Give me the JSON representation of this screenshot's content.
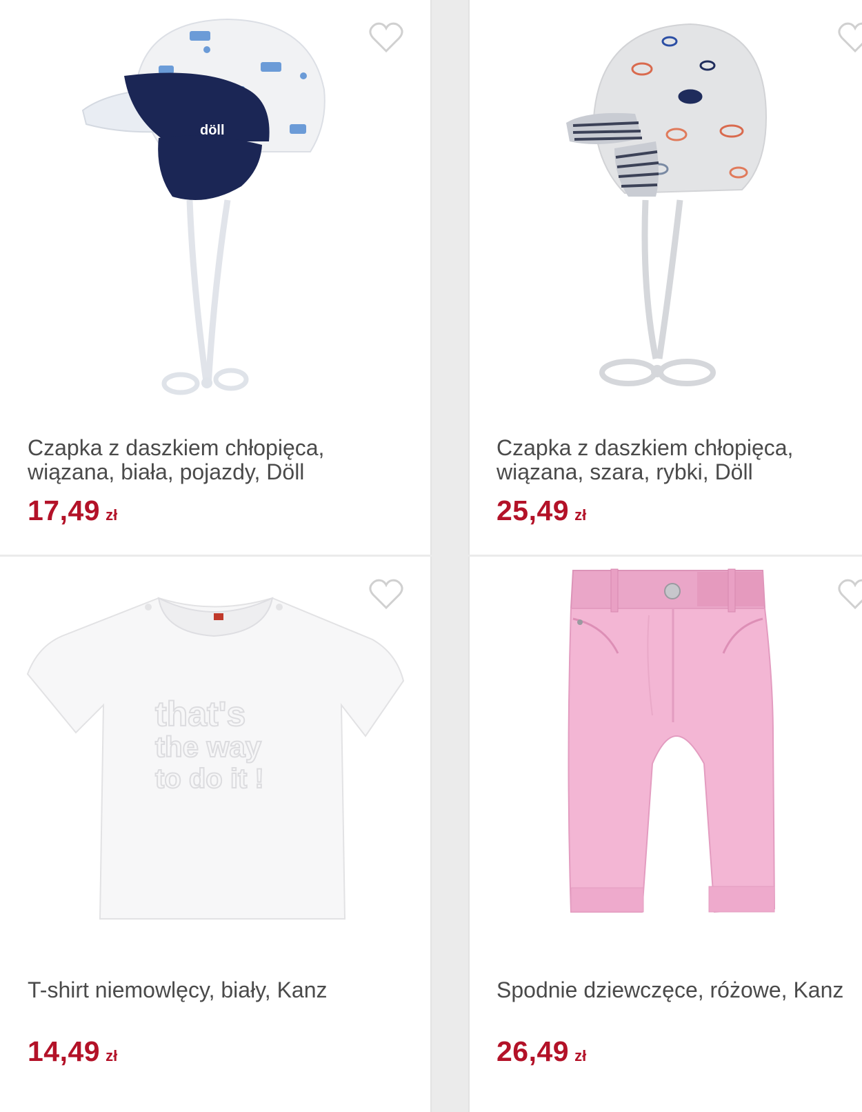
{
  "products": [
    {
      "name": "Czapka z daszkiem chłopięca,",
      "name_line2": "wiązana, biała, pojazdy, Döll",
      "price": "17,49",
      "currency": "zł",
      "logo_text": "döll"
    },
    {
      "name": "Czapka z daszkiem chłopięca,",
      "name_line2": "wiązana, szara, rybki, Döll",
      "price": "25,49",
      "currency": "zł"
    },
    {
      "name": "T-shirt niemowlęcy, biały, Kanz",
      "price": "14,49",
      "currency": "zł",
      "print_text": [
        "that's",
        "the way",
        "to do it !"
      ]
    },
    {
      "name": "Spodnie dziewczęce, różowe, Kanz",
      "price": "26,49",
      "currency": "zł"
    }
  ],
  "colors": {
    "price": "#b31228",
    "text": "#4a4a4a",
    "divider": "#e2e2e2",
    "heart": "#d0d0d0"
  },
  "icons": {
    "wishlist": "heart-outline-icon"
  }
}
